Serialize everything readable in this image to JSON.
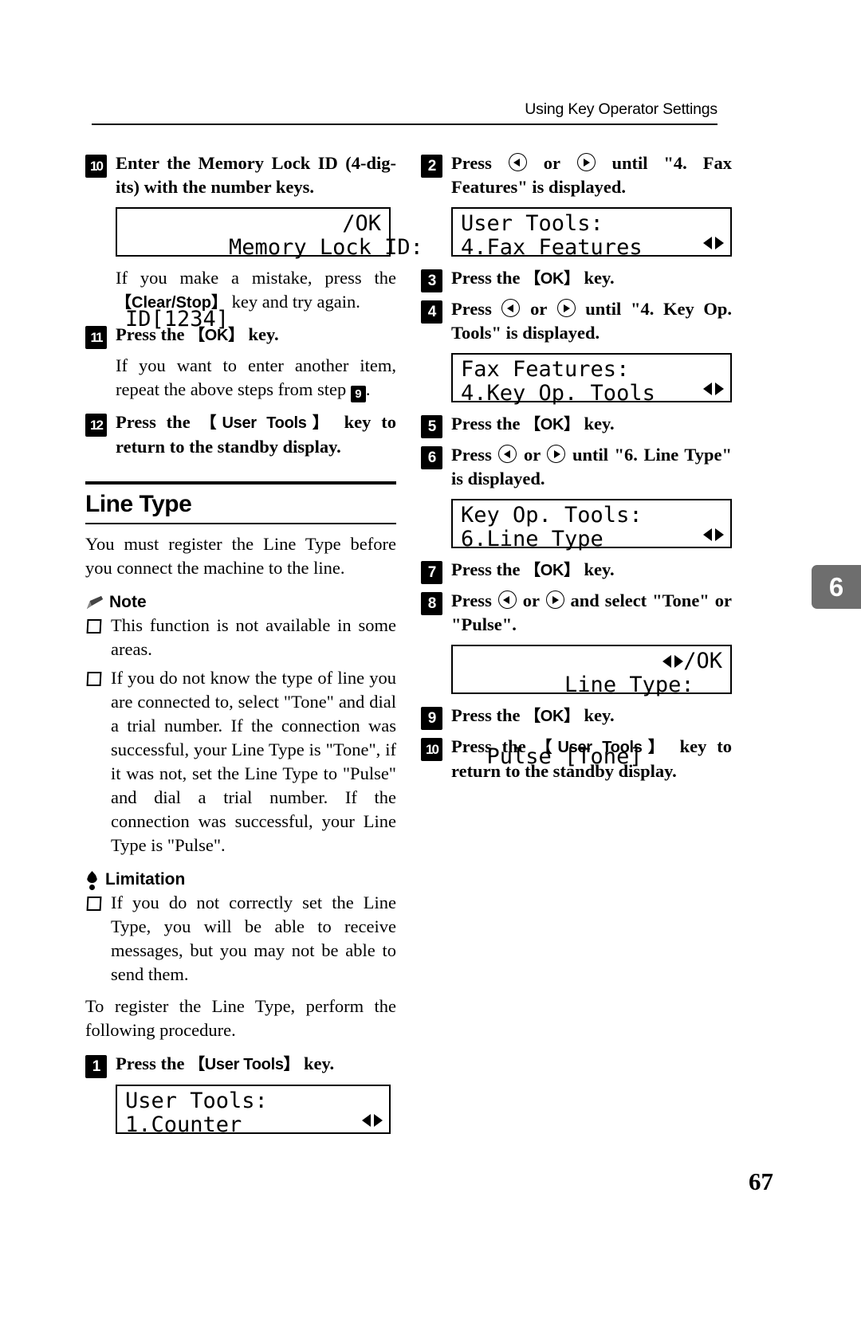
{
  "header": {
    "running_title": "Using Key Operator Settings"
  },
  "chapter_tab": "6",
  "page_number": "67",
  "left_column": {
    "step10": {
      "num": "10",
      "text_a": "Enter the Memory Lock ID (4-dig-its) with the number keys."
    },
    "lcd1": {
      "line1_left": "Memory Lock ID:",
      "line1_right": "/OK",
      "line2": "ID[1234]"
    },
    "note_mistake_a": "If you make a mistake, press the ",
    "note_mistake_key": "【Clear/Stop】",
    "note_mistake_b": " key and try again.",
    "step11": {
      "num": "11",
      "text_a": "Press the ",
      "key": "【OK】",
      "text_b": " key."
    },
    "step11_note_a": "If you want to enter another item, repeat the above steps from step ",
    "step11_note_ref": "9",
    "step11_note_b": ".",
    "step12": {
      "num": "12",
      "text_a": "Press the ",
      "key": "【User Tools】",
      "text_b": " key to return to the standby display."
    },
    "section": {
      "title": "Line Type",
      "intro": "You must register the Line Type before you connect the machine to the line."
    },
    "note": {
      "label": "Note",
      "items": [
        "This function is not available in some areas.",
        "If you do not know the type of line you are connected to, select \"Tone\" and dial a trial number. If the connection was successful, your Line Type is \"Tone\", if it was not, set the Line Type to \"Pulse\" and dial a trial number. If the connection was successful, your Line Type is \"Pulse\"."
      ]
    },
    "limitation": {
      "label": "Limitation",
      "items": [
        "If you do not correctly set the Line Type, you will be able to receive messages, but you may not be able to send them."
      ]
    },
    "procedure_intro": "To register the Line Type, perform the following procedure.",
    "step1": {
      "num": "1",
      "text_a": "Press the ",
      "key": "【User Tools】",
      "text_b": " key."
    },
    "lcd2": {
      "line1": "User Tools:",
      "line2": "1.Counter",
      "arrows": "left-right-arrows"
    }
  },
  "right_column": {
    "step2": {
      "num": "2",
      "text_a": "Press ",
      "text_b": " or ",
      "text_c": " until \"4. Fax Features\" is displayed."
    },
    "lcd3": {
      "line1": "User Tools:",
      "line2": "4.Fax Features",
      "arrows": "left-right-arrows"
    },
    "step3": {
      "num": "3",
      "text_a": "Press the ",
      "key": "【OK】",
      "text_b": " key."
    },
    "step4": {
      "num": "4",
      "text_a": "Press ",
      "text_b": " or ",
      "text_c": " until \"4. Key Op. Tools\" is displayed."
    },
    "lcd4": {
      "line1": "Fax Features:",
      "line2": "4.Key Op. Tools",
      "arrows": "left-right-arrows"
    },
    "step5": {
      "num": "5",
      "text_a": "Press the ",
      "key": "【OK】",
      "text_b": " key."
    },
    "step6": {
      "num": "6",
      "text_a": "Press ",
      "text_b": " or ",
      "text_c": " until \"6. Line Type\" is displayed."
    },
    "lcd5": {
      "line1": "Key Op. Tools:",
      "line2": "6.Line Type",
      "arrows": "left-right-arrows"
    },
    "step7": {
      "num": "7",
      "text_a": "Press the ",
      "key": "【OK】",
      "text_b": " key."
    },
    "step8": {
      "num": "8",
      "text_a": "Press ",
      "text_b": " or ",
      "text_c": " and select \"Tone\" or \"Pulse\"."
    },
    "lcd6": {
      "line1_left": "Line Type:",
      "line1_right": "/OK",
      "line2": "  Pulse [Tone]"
    },
    "step9": {
      "num": "9",
      "text_a": "Press the ",
      "key": "【OK】",
      "text_b": " key."
    },
    "step10": {
      "num": "10",
      "text_a": "Press the ",
      "key": "【User Tools】",
      "text_b": " key to return to the standby display."
    }
  }
}
